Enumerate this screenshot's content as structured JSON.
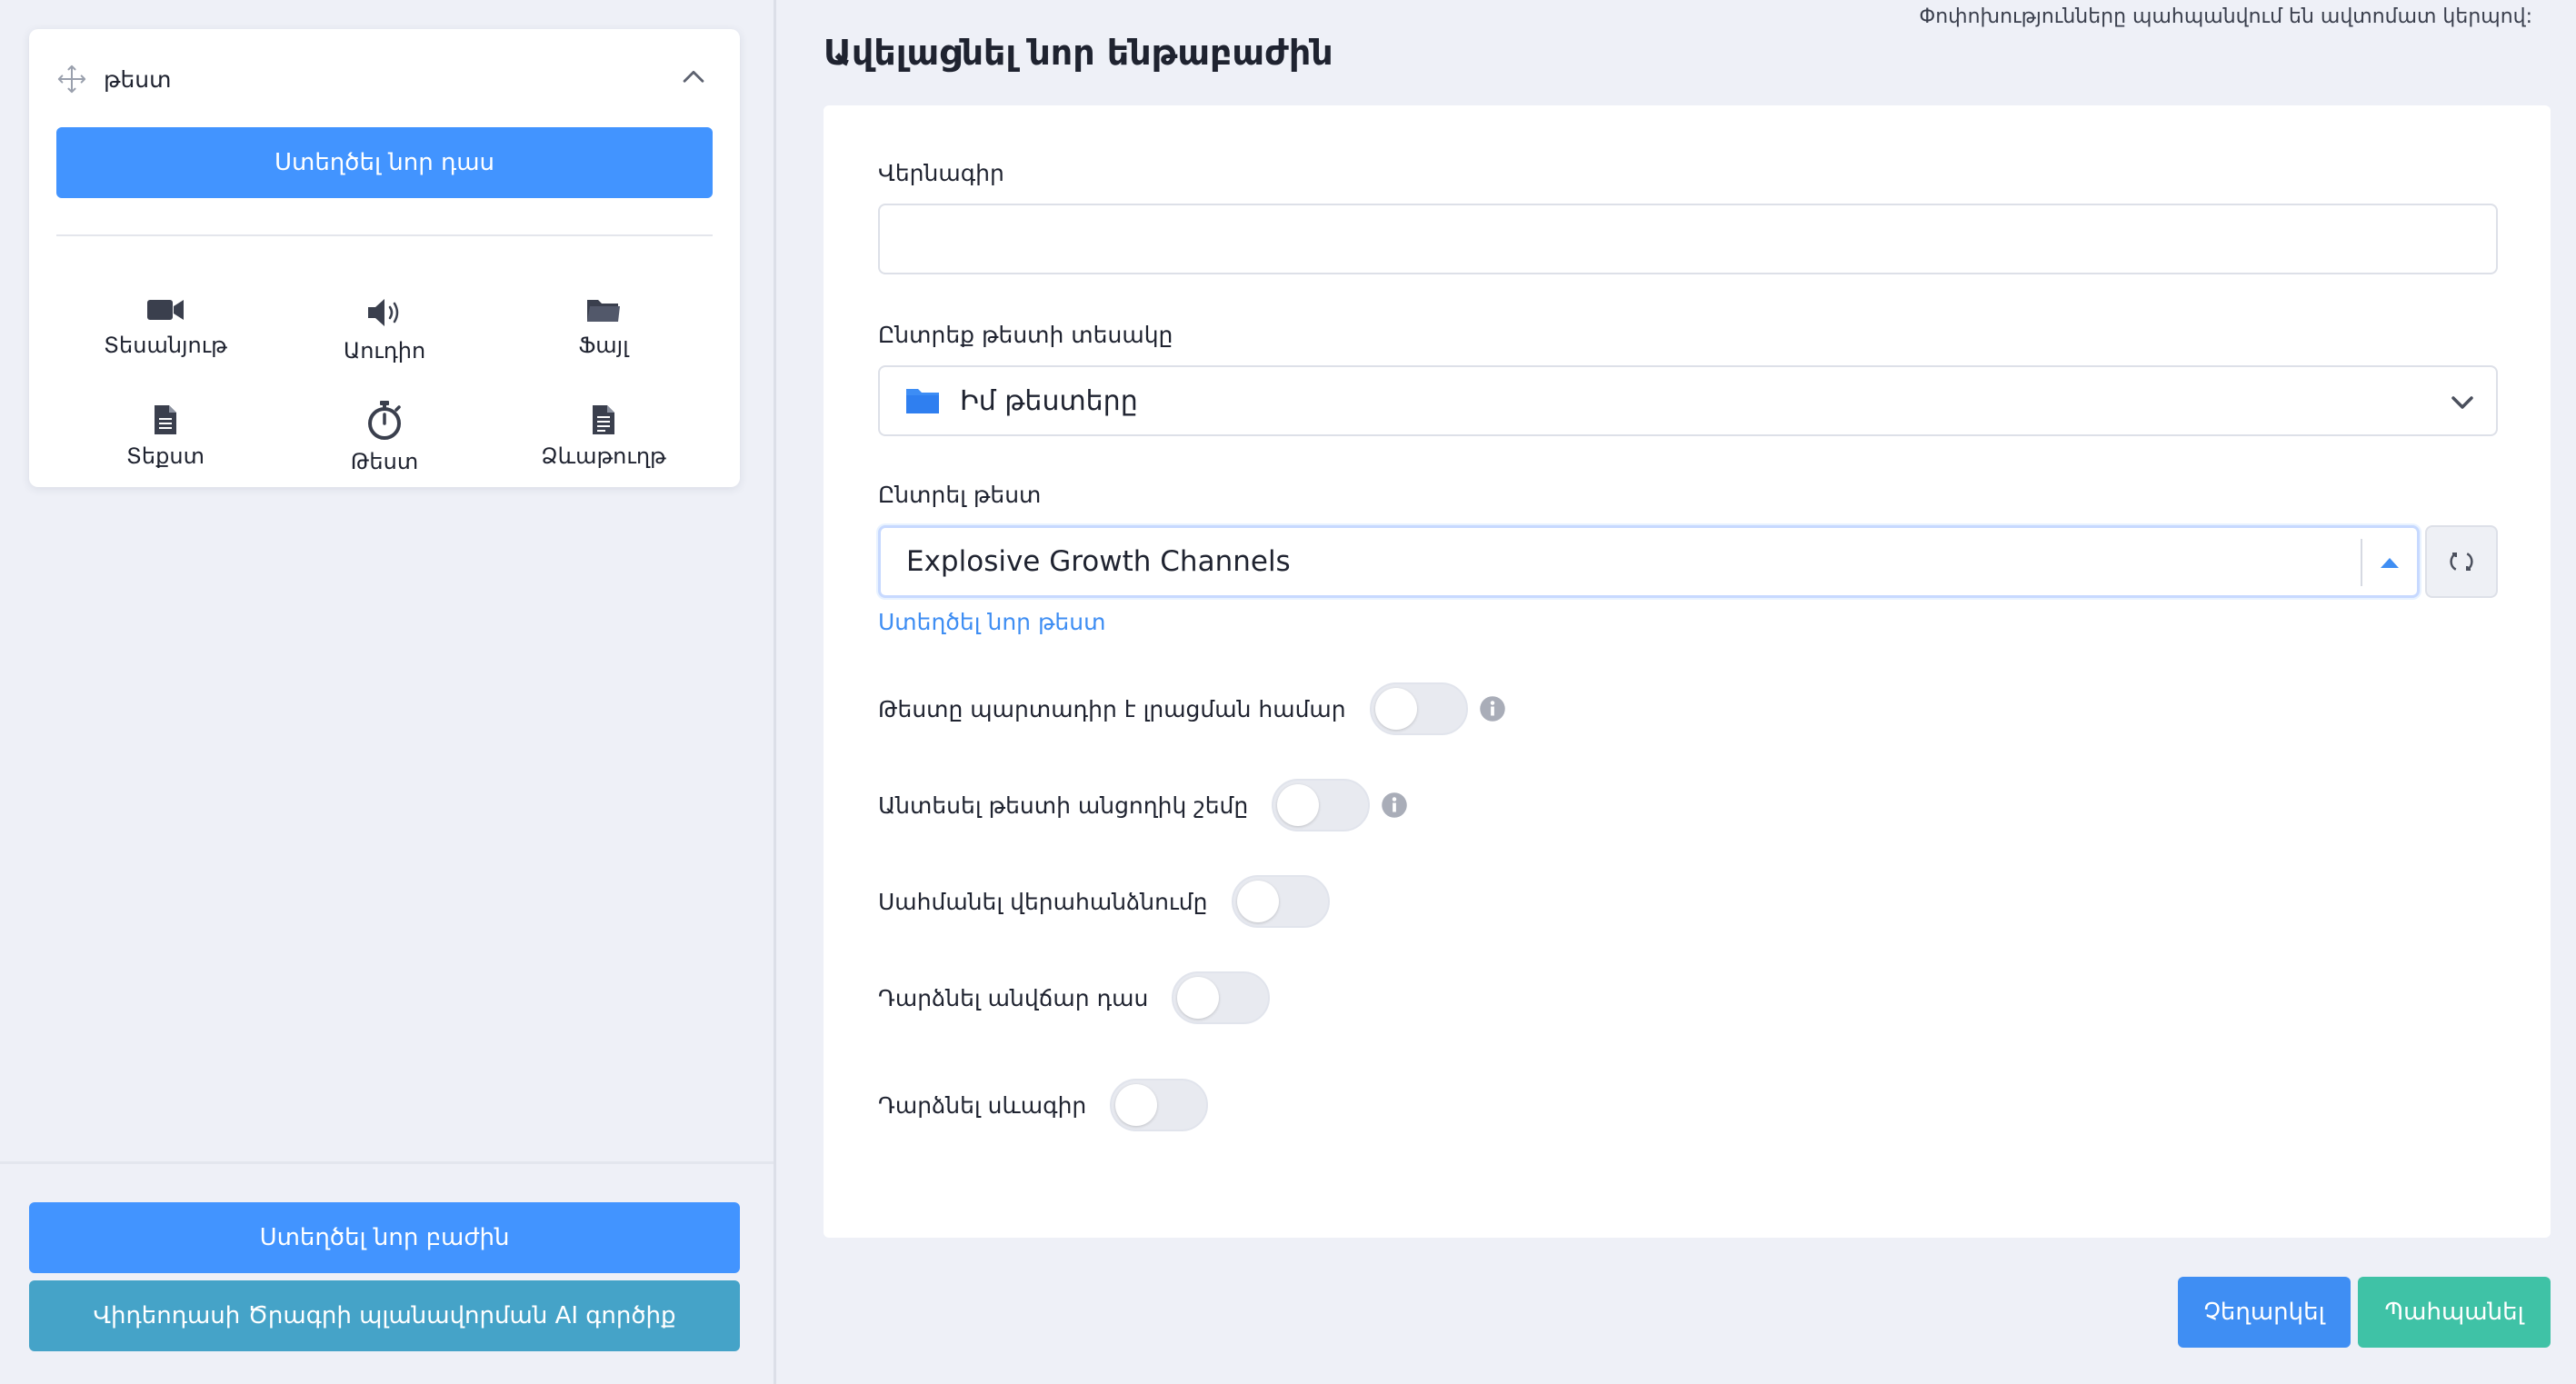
{
  "autosave_note": "Փոփոխությունները պահպանվում են ավտոմատ կերպով:",
  "sidebar": {
    "lesson_card": {
      "title": "թեստ",
      "new_lesson_label": "Ստեղծել նոր դաս",
      "types": [
        {
          "icon": "video-camera-icon",
          "label": "Տեսանյութ"
        },
        {
          "icon": "audio-speaker-icon",
          "label": "Աուդիո"
        },
        {
          "icon": "folder-icon",
          "label": "Ֆայլ"
        },
        {
          "icon": "text-document-icon",
          "label": "Տեքստ"
        },
        {
          "icon": "stopwatch-icon",
          "label": "Թեստ"
        },
        {
          "icon": "assignment-document-icon",
          "label": "Ձևաթուղթ"
        }
      ]
    },
    "new_section_label": "Ստեղծել նոր բաժին",
    "ai_tool_label": "Վիդեոդասի Ծրագրի պլանավորման AI գործիք"
  },
  "main": {
    "page_title": "Ավելացնել նոր ենթաբաժին",
    "title_field": {
      "label": "Վերնագիր",
      "value": ""
    },
    "test_type_field": {
      "label": "Ընտրեք թեստի տեսակը",
      "value": "Իմ թեստերը"
    },
    "test_field": {
      "label": "Ընտրել թեստ",
      "value": "Explosive Growth Channels",
      "create_link": "Ստեղծել նոր թեստ"
    },
    "toggles": [
      {
        "label": "Թեստը պարտադիր է լրացման համար",
        "on": false,
        "info": true
      },
      {
        "label": "Անտեսել թեստի անցողիկ շեմը",
        "on": false,
        "info": true
      },
      {
        "label": "Սահմանել վերահանձնումը",
        "on": false,
        "info": false
      },
      {
        "label": "Դարձնել անվճար դաս",
        "on": false,
        "info": false
      },
      {
        "label": "Դարձնել սևագիր",
        "on": false,
        "info": false
      }
    ],
    "cancel_label": "Չեղարկել",
    "save_label": "Պահպանել"
  },
  "colors": {
    "primary": "#4294ff",
    "ai_button": "#45a3c8",
    "save": "#3fc2a6",
    "link": "#3f8ef3",
    "background": "#eef0f7"
  }
}
